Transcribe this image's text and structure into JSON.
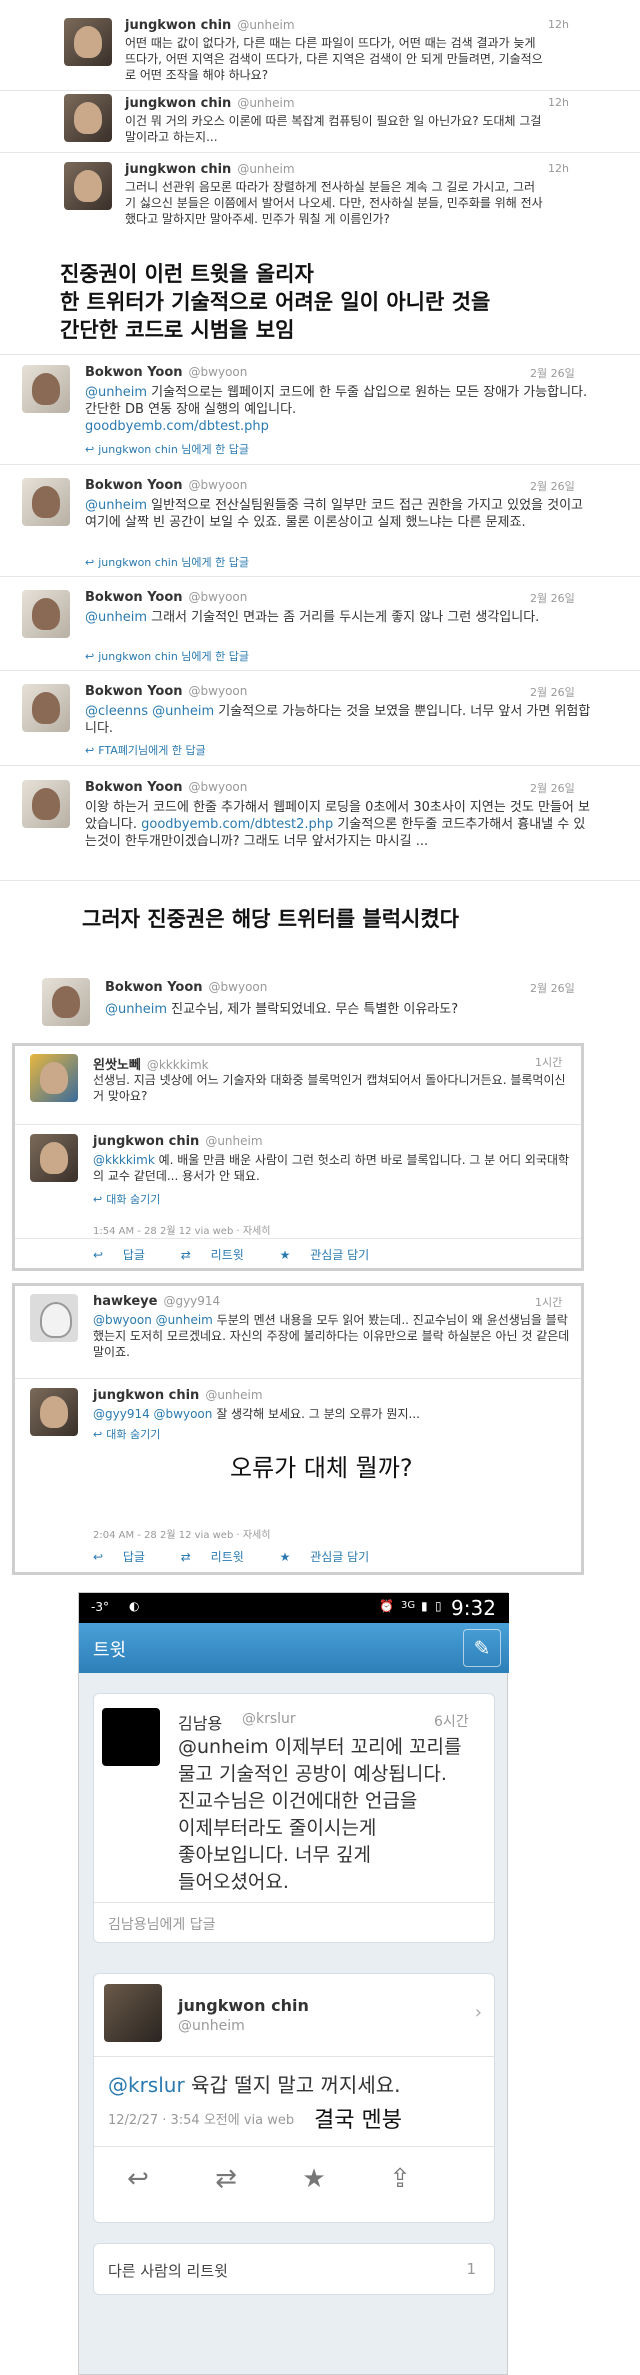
{
  "top_tweets": [
    {
      "name": "jungkwon chin",
      "handle": "@unheim",
      "time": "12h",
      "text": "어떤 때는 값이 없다가, 다른 때는 다른 파일이 뜨다가, 어떤 때는 검색 결과가 늦게 뜨다가, 어떤 지역은 검색이 뜨다가, 다른 지역은 검색이 안 되게 만들려면, 기술적으로 어떤 조작을 해야 하나요?"
    },
    {
      "name": "jungkwon chin",
      "handle": "@unheim",
      "time": "12h",
      "text": "이건 뭐 거의 카오스 이론에 따른 복잡계 컴퓨팅이 필요한 일 아닌가요? 도대체 그걸 말이라고 하는지..."
    },
    {
      "name": "jungkwon chin",
      "handle": "@unheim",
      "time": "12h",
      "text": "그러니 선관위 음모론 따라가 장렬하게 전사하실 분들은 계속 그 길로 가시고, 그러기 싫으신 분들은 이쯤에서 발어서 나오세. 다만, 전사하실 분들, 민주화를 위해 전사했다고 말하지만 말아주세. 민주가 뭐칠 게 이름인가?"
    }
  ],
  "headline1": [
    "진중권이 이런 트윗을 올리자",
    "한 트위터가 기술적으로 어려운 일이 아니란 것을",
    "간단한 코드로 시범을 보임"
  ],
  "bw_tweets": [
    {
      "name": "Bokwon Yoon",
      "handle": "@bwyoon",
      "time": "2월 26일",
      "mention": "@unheim",
      "text": " 기술적으로는 웹페이지 코드에 한 두줄 삽입으로 원하는 모든 장애가 가능합니다. 간단한 DB 연동 장애 실행의 예입니다.",
      "link": "goodbyemb.com/dbtest.php",
      "reply": "jungkwon chin 님에게 한 답글"
    },
    {
      "name": "Bokwon Yoon",
      "handle": "@bwyoon",
      "time": "2월 26일",
      "mention": "@unheim",
      "text": " 일반적으로 전산실팀원들중 극히 일부만 코드 접근 권한을 가지고 있었을 것이고 여기에 살짝 빈 공간이 보일 수 있죠. 물론 이론상이고 실제 했느냐는 다른 문제죠.",
      "link": "",
      "reply": "jungkwon chin 님에게 한 답글"
    },
    {
      "name": "Bokwon Yoon",
      "handle": "@bwyoon",
      "time": "2월 26일",
      "mention": "@unheim",
      "text": " 그래서 기술적인 면과는 좀 거리를 두시는게 좋지 않나 그런 생각입니다.",
      "link": "",
      "reply": "jungkwon chin 님에게 한 답글"
    },
    {
      "name": "Bokwon Yoon",
      "handle": "@bwyoon",
      "time": "2월 26일",
      "mention": "@cleenns @unheim",
      "text": " 기술적으로 가능하다는 것을 보였을 뿐입니다. 너무 앞서 가면 위험합니다.",
      "link": "",
      "reply": "FTA폐기님에게 한 답글"
    },
    {
      "name": "Bokwon Yoon",
      "handle": "@bwyoon",
      "time": "2월 26일",
      "mention": "",
      "text": "이왕 하는거 코드에 한줄 추가해서 웹페이지 로딩을 0초에서 30초사이 지연는 것도 만들어 보았습니다. ",
      "link": "goodbyemb.com/dbtest2.php",
      "text2": " 기술적으론 한두줄 코드추가해서 흉내낼 수 있는것이 한두개만이겠습니까? 그래도 너무 앞서가지는 마시길 ...",
      "reply": ""
    }
  ],
  "headline2": "그러자 진중권은 해당 트위터를 블럭시켰다",
  "blocked_tweet": {
    "name": "Bokwon Yoon",
    "handle": "@bwyoon",
    "time": "2월 26일",
    "mention": "@unheim",
    "text": " 진교수님, 제가 블락되었네요. 무슨 특별한 이유라도?"
  },
  "box1": {
    "q": {
      "name": "왼쌋노뻬",
      "handle": "@kkkkimk",
      "time": "1시간",
      "text": "선생님. 지금 넷상에 어느 기술자와 대화중 블록먹인거 캡쳐되어서 돌아다니거든요. 블록먹이신거 맞아요?"
    },
    "a": {
      "name": "jungkwon chin",
      "handle": "@unheim",
      "mention": "@kkkkimk",
      "text": " 예. 배울 만큼 배운 사람이 그런 헛소리 하면 바로 블록입니다. 그 분 어디 외국대학의 교수 같던데... 용서가 안 돼요.",
      "reply": "대화 숨기기"
    },
    "meta": "1:54 AM - 28 2월 12 via web · 자세히",
    "actions": [
      "답글",
      "리트윗",
      "관심글 담기"
    ]
  },
  "box2": {
    "q": {
      "name": "hawkeye",
      "handle": "@gyy914",
      "time": "1시간",
      "mention": "@bwyoon @unheim",
      "text": " 두분의 멘션 내용을 모두 읽어 봤는데.. 진교수님이 왜 윤선생님을 블락했는지 도저히 모르겠네요. 자신의 주장에 불리하다는 이유만으로 블락 하실분은 아닌 것 같은데 말이죠."
    },
    "a": {
      "name": "jungkwon chin",
      "handle": "@unheim",
      "mention": "@gyy914 @bwyoon",
      "text": " 잘 생각해 보세요. 그 분의 오류가 뭔지...",
      "reply": "대화 숨기기"
    },
    "overlay": "오류가 대체 뭘까?",
    "meta": "2:04 AM - 28 2월 12 via web · 자세히",
    "actions": [
      "답글",
      "리트윗",
      "관심글 담기"
    ]
  },
  "phone": {
    "status_left": "-3°",
    "status_net": "3G",
    "clock": "9:32",
    "app_title": "트윗",
    "tweet1": {
      "name": "김남용",
      "handle": "@krslur",
      "time": "6시간",
      "lines": [
        "@unheim 이제부터 꼬리에 꼬리를",
        "물고 기술적인 공방이 예상됩니다.",
        "진교수님은 이건에대한 언급을",
        "이제부터라도 줄이시는게",
        "좋아보입니다. 너무 깊게",
        "들어오셨어요."
      ],
      "reply": "김남용님에게 답글"
    },
    "tweet2": {
      "name": "jungkwon chin",
      "handle": "@unheim",
      "mention": "@krslur",
      "text": " 육갑 떨지 말고 꺼지세요.",
      "meta": "12/2/27 · 3:54 오전에 via web",
      "overlay": "결국 멘붕"
    },
    "retweets_label": "다른 사람의 리트윗",
    "retweets_count": "1"
  }
}
